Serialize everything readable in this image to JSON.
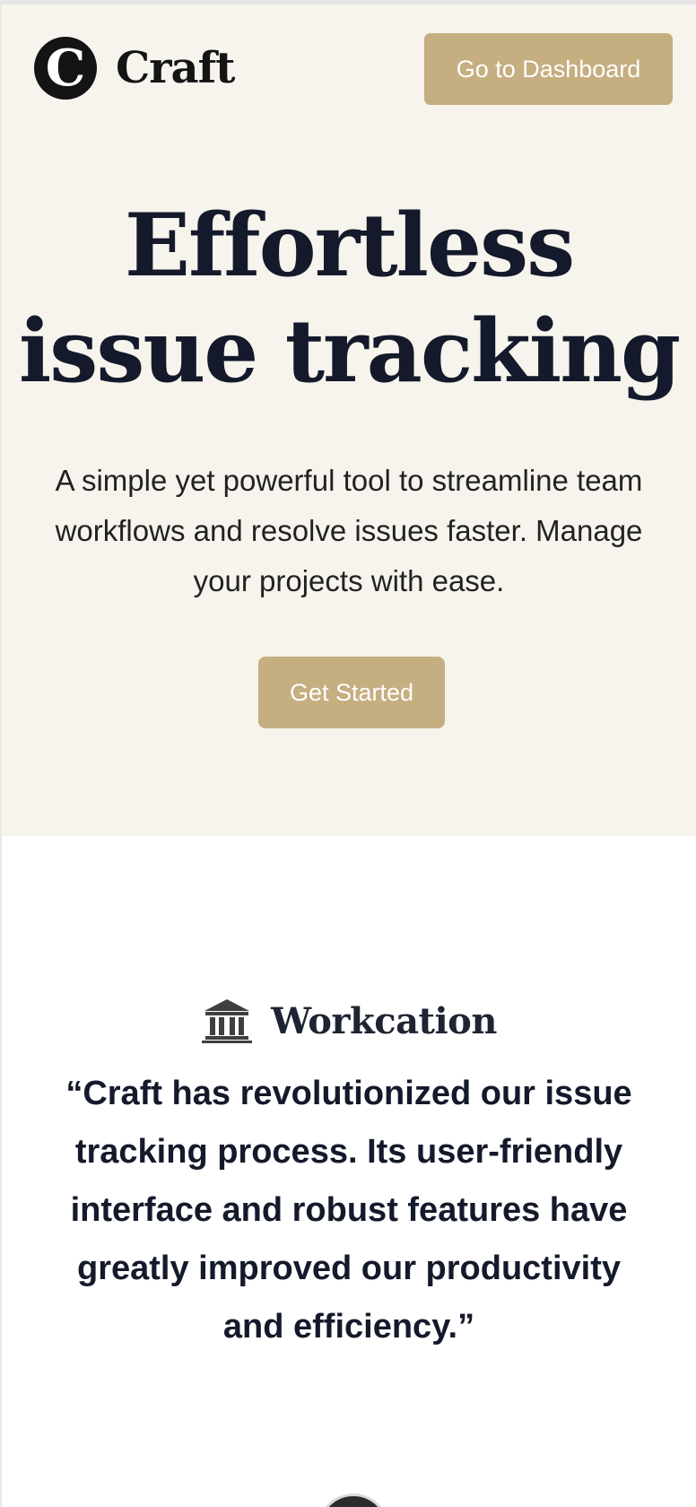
{
  "brand": {
    "logo_letter": "C",
    "name": "Craft"
  },
  "header": {
    "dashboard_label": "Go to Dashboard"
  },
  "hero": {
    "headline_line1": "Effortless",
    "headline_line2": "issue tracking",
    "subtitle": "A simple yet powerful tool to streamline team workflows and resolve issues faster. Manage your projects with ease.",
    "cta_label": "Get Started"
  },
  "testimonial": {
    "company_icon": "bank-icon",
    "company_name": "Workcation",
    "quote": "“Craft has revolutionized our issue tracking process. Its user-friendly interface and robust features have greatly improved our productivity and efficiency.”"
  },
  "colors": {
    "accent": "#c5ae80",
    "hero_bg": "#f6f4ec",
    "heading": "#141a2b"
  }
}
